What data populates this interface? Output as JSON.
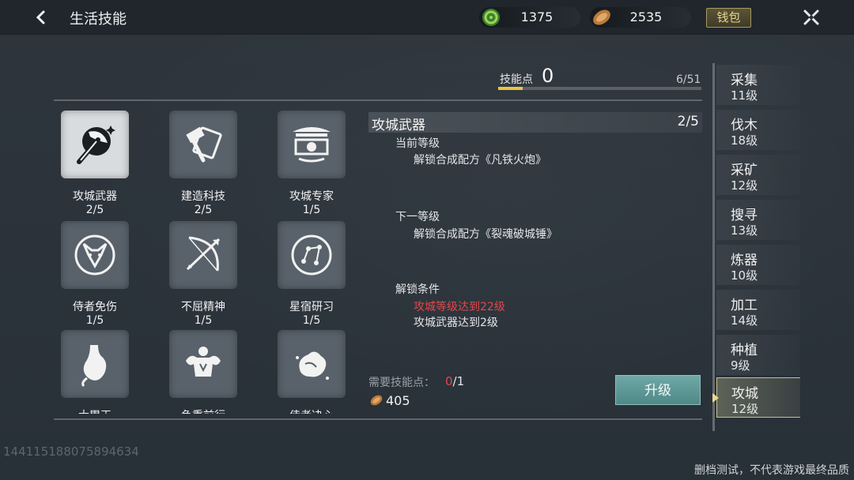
{
  "header": {
    "title": "生活技能",
    "currency": [
      {
        "icon": "jade-coin-icon",
        "value": "1375",
        "color": "#5fa334"
      },
      {
        "icon": "copper-coin-icon",
        "value": "2535",
        "color": "#b97a3a"
      }
    ],
    "wallet_label": "钱包"
  },
  "skill_points": {
    "label": "技能点",
    "value": "0",
    "count": "6/51",
    "progress": 0.12
  },
  "skills": [
    {
      "name": "攻城武器",
      "level": "2/5",
      "icon": "siege-axe-icon",
      "selected": true
    },
    {
      "name": "建造科技",
      "level": "2/5",
      "icon": "hammer-blueprint-icon",
      "selected": false
    },
    {
      "name": "攻城专家",
      "level": "1/5",
      "icon": "fortress-gate-icon",
      "selected": false
    },
    {
      "name": "侍者免伤",
      "level": "1/5",
      "icon": "fox-mask-icon",
      "selected": false
    },
    {
      "name": "不屈精神",
      "level": "1/5",
      "icon": "bow-arrow-icon",
      "selected": false
    },
    {
      "name": "星宿研习",
      "level": "1/5",
      "icon": "constellation-icon",
      "selected": false
    },
    {
      "name": "大胃王",
      "level": "",
      "icon": "stomach-icon",
      "selected": false
    },
    {
      "name": "负重前行",
      "level": "",
      "icon": "muscle-icon",
      "selected": false
    },
    {
      "name": "侍者决心",
      "level": "",
      "icon": "spirit-beast-icon",
      "selected": false
    }
  ],
  "detail": {
    "title": "攻城武器",
    "level": "2/5",
    "current_heading": "当前等级",
    "current_text": "解锁合成配方《凡铁火炮》",
    "next_heading": "下一等级",
    "next_text": "解锁合成配方《裂魂破城锤》",
    "cond_heading": "解锁条件",
    "cond_1": "攻城等级达到22级",
    "cond_2": "攻城武器达到2级",
    "need_label": "需要技能点：",
    "need_have": "0",
    "need_total": "/1",
    "cost": "405",
    "upgrade_label": "升级"
  },
  "categories": [
    {
      "name": "采集",
      "level": "11级",
      "active": false
    },
    {
      "name": "伐木",
      "level": "18级",
      "active": false
    },
    {
      "name": "采矿",
      "level": "12级",
      "active": false
    },
    {
      "name": "搜寻",
      "level": "13级",
      "active": false
    },
    {
      "name": "炼器",
      "level": "10级",
      "active": false
    },
    {
      "name": "加工",
      "level": "14级",
      "active": false
    },
    {
      "name": "种植",
      "level": "9级",
      "active": false
    },
    {
      "name": "攻城",
      "level": "12级",
      "active": true
    }
  ],
  "footer": {
    "id": "1441151880758946​34",
    "disclaimer": "删档测试，不代表游戏最终品质"
  }
}
